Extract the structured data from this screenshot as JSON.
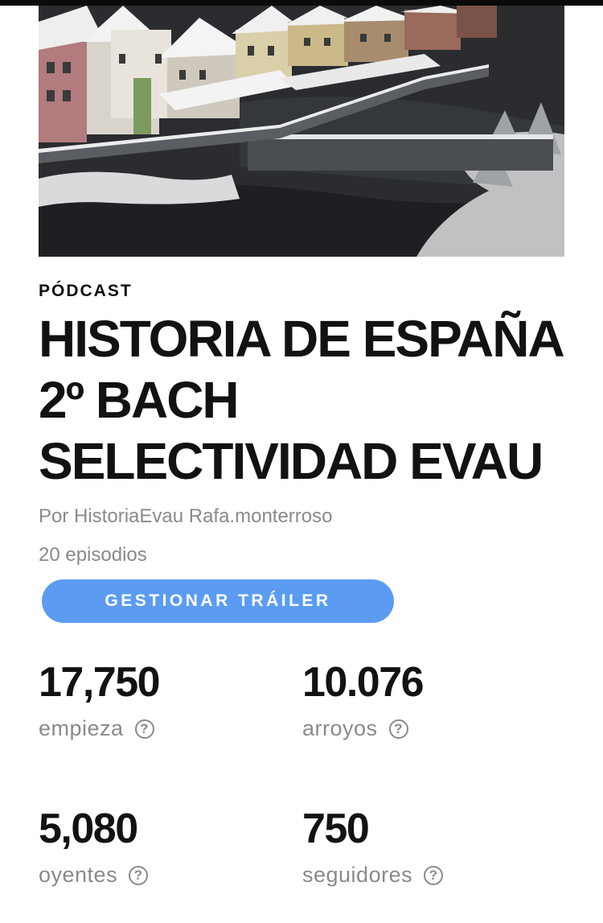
{
  "podcast": {
    "type_label": "PÓDCAST",
    "title": "HISTORIA DE ESPAÑA 2º BACH SELECTIVIDAD EVAU",
    "author": "Por HistoriaEvau Rafa.monterroso",
    "episodes": "20 episodios",
    "trailer_button": "GESTIONAR TRÁILER"
  },
  "stats": [
    {
      "value": "17,750",
      "label": "empieza",
      "help": "?"
    },
    {
      "value": "10.076",
      "label": "arroyos",
      "help": "?"
    },
    {
      "value": "5,080",
      "label": "oyentes",
      "help": "?"
    },
    {
      "value": "750",
      "label": "seguidores",
      "help": "?"
    }
  ],
  "colors": {
    "accent_button": "#5b9cf2",
    "text_primary": "#121212",
    "text_secondary": "#8a8a8a"
  }
}
